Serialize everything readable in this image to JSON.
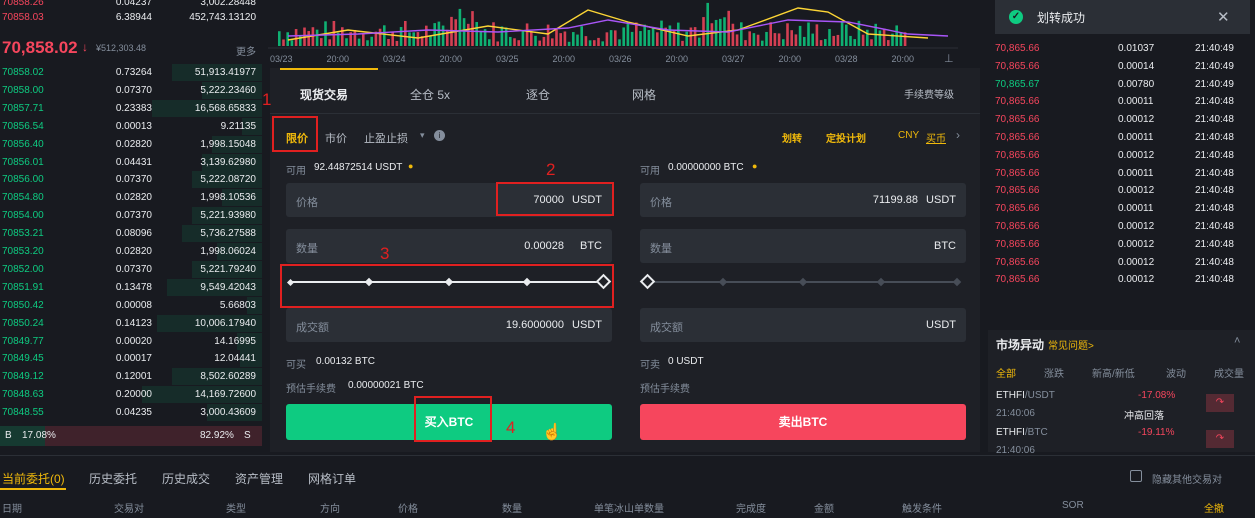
{
  "orderbook": {
    "asks_top": [
      {
        "price": "70858.26",
        "qty": "0.04237",
        "total": "3,002.28448"
      },
      {
        "price": "70858.03",
        "qty": "6.38944",
        "total": "452,743.13120"
      }
    ],
    "last_price": "70,858.02",
    "last_fiat": "¥512,303.48",
    "more_label": "更多",
    "bids": [
      {
        "price": "70858.02",
        "qty": "0.73264",
        "total": "51,913.41977"
      },
      {
        "price": "70858.00",
        "qty": "0.07370",
        "total": "5,222.23460"
      },
      {
        "price": "70857.71",
        "qty": "0.23383",
        "total": "16,568.65833"
      },
      {
        "price": "70856.54",
        "qty": "0.00013",
        "total": "9.21135"
      },
      {
        "price": "70856.40",
        "qty": "0.02820",
        "total": "1,998.15048"
      },
      {
        "price": "70856.01",
        "qty": "0.04431",
        "total": "3,139.62980"
      },
      {
        "price": "70856.00",
        "qty": "0.07370",
        "total": "5,222.08720"
      },
      {
        "price": "70854.80",
        "qty": "0.02820",
        "total": "1,998.10536"
      },
      {
        "price": "70854.00",
        "qty": "0.07370",
        "total": "5,221.93980"
      },
      {
        "price": "70853.21",
        "qty": "0.08096",
        "total": "5,736.27588"
      },
      {
        "price": "70853.20",
        "qty": "0.02820",
        "total": "1,998.06024"
      },
      {
        "price": "70852.00",
        "qty": "0.07370",
        "total": "5,221.79240"
      },
      {
        "price": "70851.91",
        "qty": "0.13478",
        "total": "9,549.42043"
      },
      {
        "price": "70850.42",
        "qty": "0.00008",
        "total": "5.66803"
      },
      {
        "price": "70850.24",
        "qty": "0.14123",
        "total": "10,006.17940"
      },
      {
        "price": "70849.77",
        "qty": "0.00020",
        "total": "14.16995"
      },
      {
        "price": "70849.45",
        "qty": "0.00017",
        "total": "12.04441"
      },
      {
        "price": "70849.12",
        "qty": "0.12001",
        "total": "8,502.60289"
      },
      {
        "price": "70848.63",
        "qty": "0.20000",
        "total": "14,169.72600"
      },
      {
        "price": "70848.55",
        "qty": "0.04235",
        "total": "3,000.43609"
      }
    ],
    "foot_b": "B",
    "foot_b_pct": "17.08%",
    "foot_s_pct": "82.92%",
    "foot_s": "S"
  },
  "chart": {
    "x_labels": [
      "03/23",
      "20:00",
      "03/24",
      "20:00",
      "03/25",
      "20:00",
      "03/26",
      "20:00",
      "03/27",
      "20:00",
      "03/28",
      "20:00"
    ]
  },
  "panel": {
    "tabs": [
      "现货交易",
      "全仓 5x",
      "逐仓",
      "网格"
    ],
    "fee_link": "手续费等级",
    "order_types": [
      "限价",
      "市价",
      "止盈止损"
    ],
    "transfer": "划转",
    "dca": "定投计划",
    "cny": "CNY",
    "buy_coin": "买币",
    "buy": {
      "avail_label": "可用",
      "avail": "92.44872514 USDT",
      "price_label": "价格",
      "price": "70000",
      "price_unit": "USDT",
      "qty_label": "数量",
      "qty": "0.00028",
      "qty_unit": "BTC",
      "total_label": "成交额",
      "total": "19.6000000",
      "total_unit": "USDT",
      "can_label": "可买",
      "can": "0.00132 BTC",
      "fee_label": "预估手续费",
      "fee": "0.00000021 BTC",
      "button": "买入BTC"
    },
    "sell": {
      "avail_label": "可用",
      "avail": "0.00000000 BTC",
      "price_label": "价格",
      "price": "71199.88",
      "price_unit": "USDT",
      "qty_label": "数量",
      "qty_unit": "BTC",
      "total_label": "成交额",
      "total_unit": "USDT",
      "can_label": "可卖",
      "can": "0 USDT",
      "fee_label": "预估手续费",
      "button": "卖出BTC"
    },
    "annotations": [
      "1",
      "2",
      "3",
      "4"
    ]
  },
  "toast": {
    "text": "划转成功"
  },
  "trades": [
    {
      "p": "70,865.66",
      "q": "0.01037",
      "t": "21:40:49",
      "c": "red"
    },
    {
      "p": "70,865.66",
      "q": "0.00014",
      "t": "21:40:49",
      "c": "red"
    },
    {
      "p": "70,865.67",
      "q": "0.00780",
      "t": "21:40:49",
      "c": "green"
    },
    {
      "p": "70,865.66",
      "q": "0.00011",
      "t": "21:40:48",
      "c": "red"
    },
    {
      "p": "70,865.66",
      "q": "0.00012",
      "t": "21:40:48",
      "c": "red"
    },
    {
      "p": "70,865.66",
      "q": "0.00011",
      "t": "21:40:48",
      "c": "red"
    },
    {
      "p": "70,865.66",
      "q": "0.00012",
      "t": "21:40:48",
      "c": "red"
    },
    {
      "p": "70,865.66",
      "q": "0.00011",
      "t": "21:40:48",
      "c": "red"
    },
    {
      "p": "70,865.66",
      "q": "0.00012",
      "t": "21:40:48",
      "c": "red"
    },
    {
      "p": "70,865.66",
      "q": "0.00011",
      "t": "21:40:48",
      "c": "red"
    },
    {
      "p": "70,865.66",
      "q": "0.00012",
      "t": "21:40:48",
      "c": "red"
    },
    {
      "p": "70,865.66",
      "q": "0.00012",
      "t": "21:40:48",
      "c": "red"
    },
    {
      "p": "70,865.66",
      "q": "0.00012",
      "t": "21:40:48",
      "c": "red"
    },
    {
      "p": "70,865.66",
      "q": "0.00012",
      "t": "21:40:48",
      "c": "red"
    }
  ],
  "market": {
    "title": "市场异动",
    "faq": "常见问题>",
    "tabs": [
      "全部",
      "涨跌",
      "新高/新低",
      "波动",
      "成交量"
    ],
    "items": [
      {
        "pair": "ETHFI",
        "quote": "/USDT",
        "pct": "-17.08%",
        "time": "21:40:06",
        "desc": "冲高回落"
      },
      {
        "pair": "ETHFI",
        "quote": "/BTC",
        "pct": "-19.11%",
        "time": "21:40:06",
        "desc": "冲高回落"
      }
    ]
  },
  "bottom": {
    "tabs": [
      "当前委托(0)",
      "历史委托",
      "历史成交",
      "资产管理",
      "网格订单"
    ],
    "hide_label": "隐藏其他交易对",
    "columns": [
      "日期",
      "交易对",
      "类型",
      "方向",
      "价格",
      "数量",
      "单笔冰山单数量",
      "完成度",
      "金额",
      "触发条件",
      "SOR",
      "全撤"
    ]
  }
}
